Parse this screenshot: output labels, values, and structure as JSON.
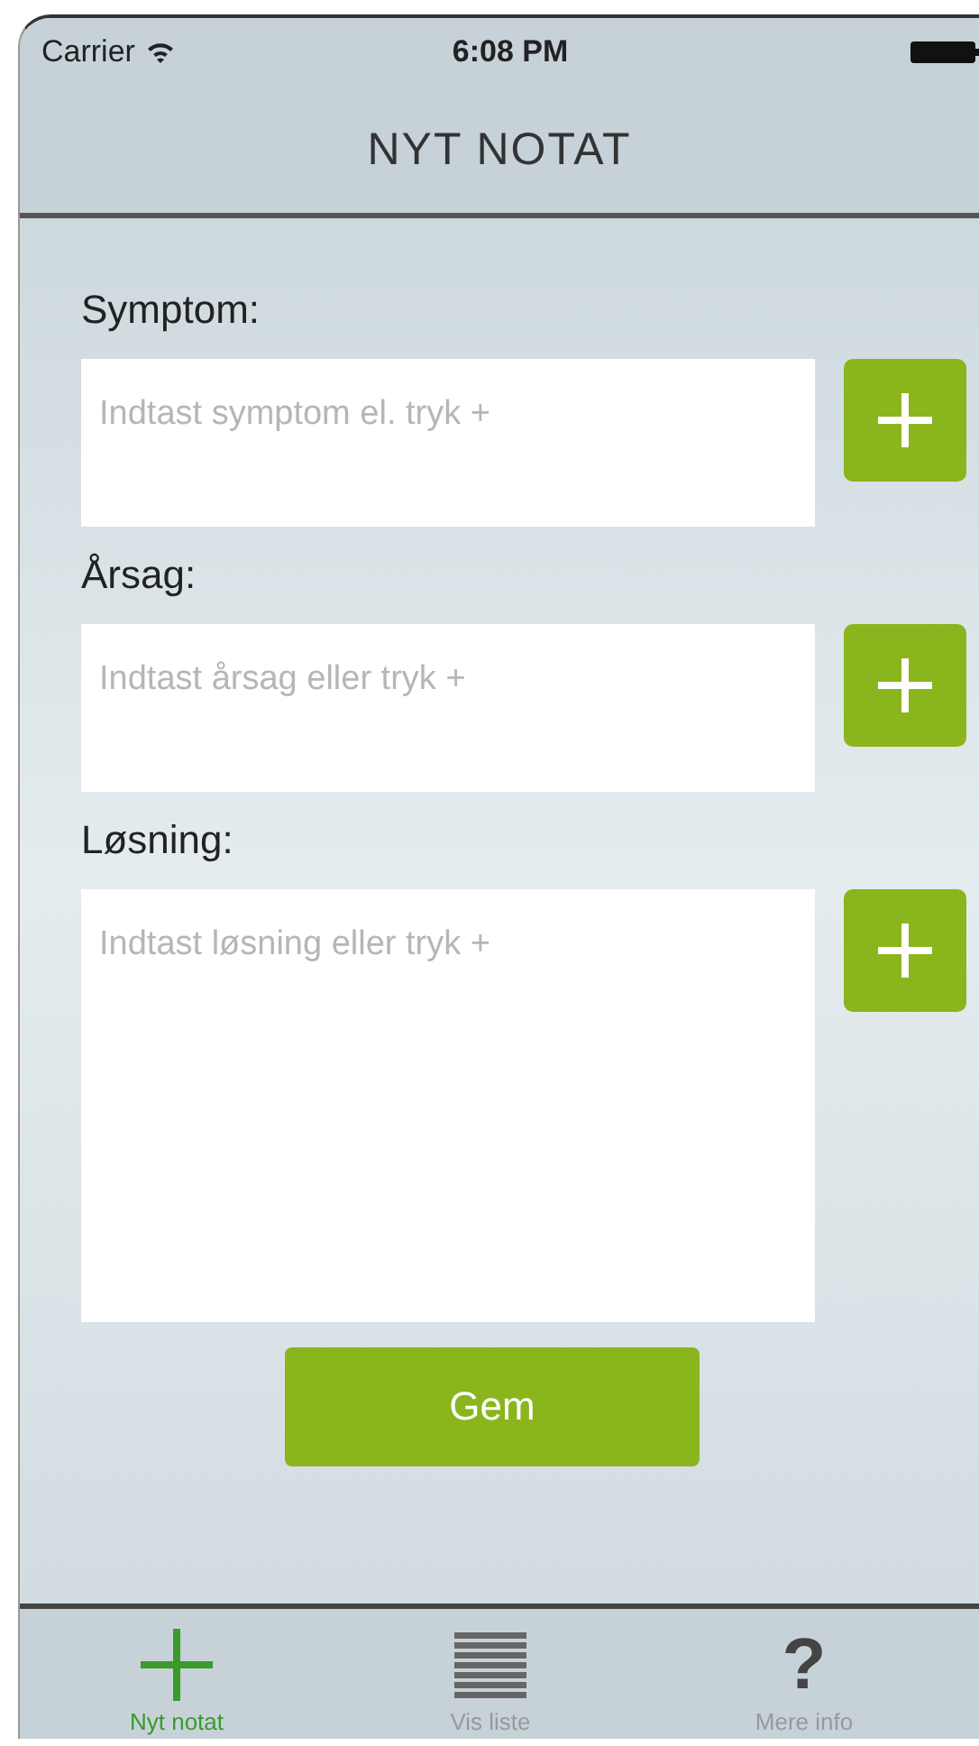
{
  "status_bar": {
    "carrier": "Carrier",
    "time": "6:08 PM"
  },
  "nav_bar": {
    "title": "NYT NOTAT"
  },
  "fields": [
    {
      "label": "Symptom:",
      "placeholder": "Indtast symptom el. tryk +",
      "kind": "short"
    },
    {
      "label": "Årsag:",
      "placeholder": "Indtast årsag eller tryk +",
      "kind": "short"
    },
    {
      "label": "Løsning:",
      "placeholder": "Indtast løsning eller tryk +",
      "kind": "tall"
    }
  ],
  "save_button": "Gem",
  "tabs": [
    {
      "label": "Nyt notat",
      "kind": "plus",
      "selected": true
    },
    {
      "label": "Vis liste",
      "kind": "list",
      "selected": false
    },
    {
      "label": "Mere info",
      "kind": "glyph",
      "glyph": "?",
      "selected": false
    }
  ]
}
